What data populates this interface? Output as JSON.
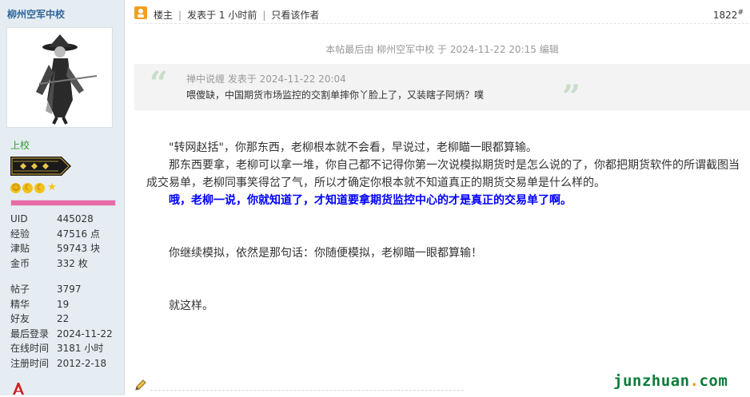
{
  "sidebar": {
    "username": "柳州空军中校",
    "rank_title": "上校",
    "exp_percent": 100,
    "stats": [
      {
        "label": "UID",
        "value": "445028"
      },
      {
        "label": "经验",
        "value": "47516 点"
      },
      {
        "label": "津贴",
        "value": "59743 块"
      },
      {
        "label": "金币",
        "value": "332 枚"
      },
      {
        "label": "帖子",
        "value": "3797"
      },
      {
        "label": "精华",
        "value": "19"
      },
      {
        "label": "好友",
        "value": "22"
      },
      {
        "label": "最后登录",
        "value": "2024-11-22"
      },
      {
        "label": "在线时间",
        "value": "3181 小时"
      },
      {
        "label": "注册时间",
        "value": "2012-2-18"
      }
    ]
  },
  "post": {
    "op_label": "楼主",
    "posted": "发表于 1 小时前",
    "only_author": "只看该作者",
    "floor_number": "1822",
    "floor_suffix": "#",
    "edit_note": "本帖最后由 柳州空军中校 于 2024-11-22 20:15 编辑",
    "quote_meta": "禅中说缠 发表于 2024-11-22 20:04",
    "quote_body": "喂傻缺，中国期货市场监控的交割单摔你丫脸上了，又装瞎子阿炳？噗",
    "para1": "\"转网赵括\"，你那东西，老柳根本就不会看，早说过，老柳瞄一眼都算输。",
    "para2": "那东西要拿，老柳可以拿一堆，你自己都不记得你第一次说模拟期货时是怎么说的了，你都把期货软件的所谓截图当成交易单，老柳同事笑得岔了气，所以才确定你根本就不知道真正的期货交易单是什么样的。",
    "para3": "哦，老柳一说，你就知道了，才知道要拿期货监控中心的才是真正的交易单了啊。",
    "para4": "你继续模拟，依然是那句话：你随便模拟，老柳瞄一眼都算输！",
    "para5": "就这样。"
  },
  "watermark": {
    "left": "junzhuan",
    "dot": ".",
    "right": "com"
  },
  "colors": {
    "sidebar_bg": "#e5edf2",
    "username": "#336699",
    "rank_title": "#339933",
    "highlight_text": "#0000ff",
    "watermark": "#0b7c3a"
  },
  "icons": [
    "avatar-image",
    "rank-badge-icon",
    "medal-icon",
    "op-icon",
    "edit-pen-icon",
    "online-status-icon"
  ]
}
